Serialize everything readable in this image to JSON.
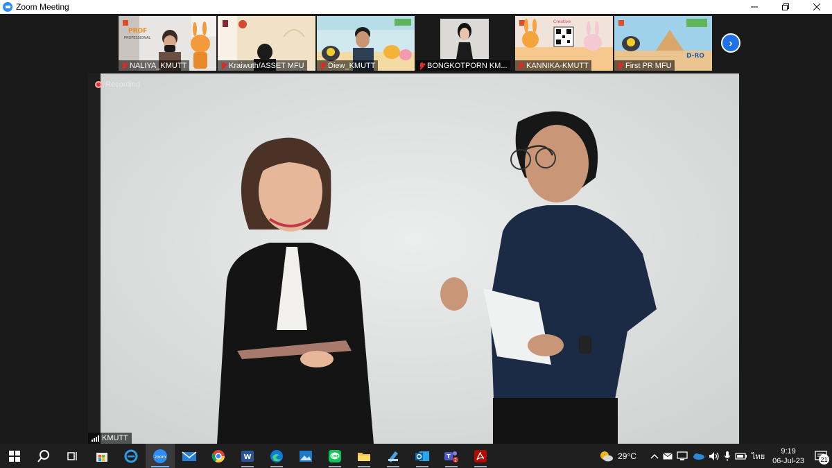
{
  "window": {
    "title": "Zoom Meeting"
  },
  "participants": [
    {
      "name": "NALIYA_KMUTT",
      "muted": true
    },
    {
      "name": "Kraiwuth/ASSET MFU",
      "muted": true
    },
    {
      "name": "Diew_KMUTT",
      "muted": true
    },
    {
      "name": "BONGKOTPORN KM...",
      "muted": true
    },
    {
      "name": "KANNIKA-KMUTT",
      "muted": true
    },
    {
      "name": "First PR MFU",
      "muted": true
    }
  ],
  "main_video": {
    "recording_label": "Recording",
    "speaker_name": "KMUTT"
  },
  "taskbar": {
    "weather": "29°C",
    "language": "ไทย",
    "time": "9:19",
    "date": "06-Jul-23",
    "notification_count": "21"
  },
  "colors": {
    "zoom_blue": "#2d8cff",
    "recording_red": "#e5312f",
    "muted_red": "#e02828",
    "taskbar_bg": "#1f1f1f"
  }
}
